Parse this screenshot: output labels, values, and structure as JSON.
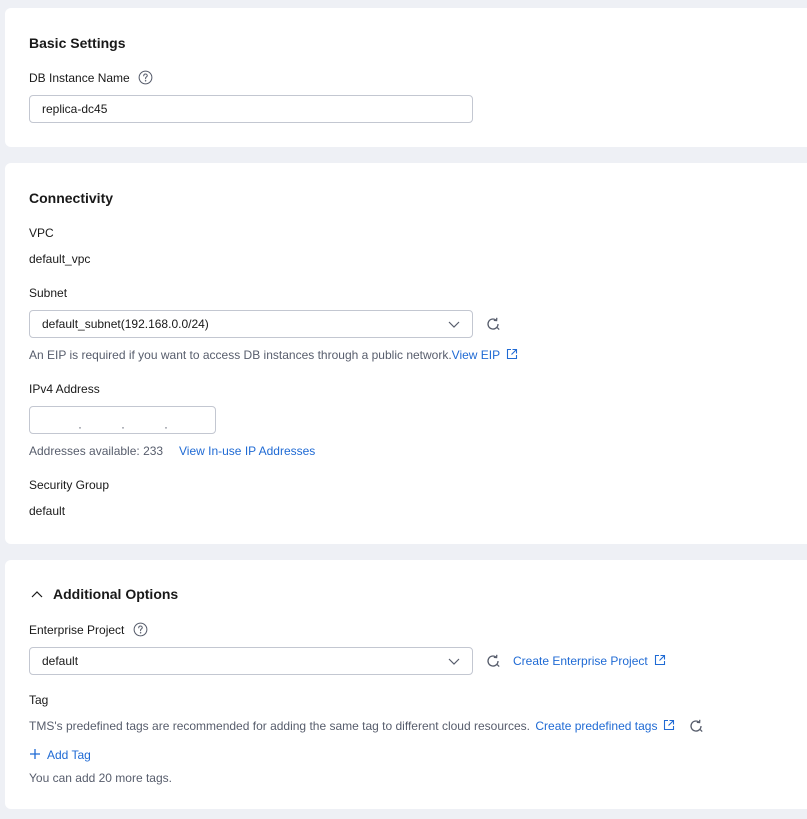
{
  "basic": {
    "title": "Basic Settings",
    "db_name_label": "DB Instance Name",
    "db_name_value": "replica-dc45"
  },
  "connectivity": {
    "title": "Connectivity",
    "vpc_label": "VPC",
    "vpc_value": "default_vpc",
    "subnet_label": "Subnet",
    "subnet_value": "default_subnet(192.168.0.0/24)",
    "eip_hint": "An EIP is required if you want to access DB instances through a public network.",
    "view_eip_link": "View EIP",
    "ipv4_label": "IPv4 Address",
    "ip_dots": [
      "·",
      "·",
      "·"
    ],
    "addresses_available": "Addresses available: 233",
    "view_inuse_link": "View In-use IP Addresses",
    "security_group_label": "Security Group",
    "security_group_value": "default"
  },
  "additional": {
    "title": "Additional Options",
    "enterprise_project_label": "Enterprise Project",
    "enterprise_project_value": "default",
    "create_enterprise_link": "Create Enterprise Project",
    "tag_label": "Tag",
    "tag_hint": "TMS's predefined tags are recommended for adding the same tag to different cloud resources.",
    "create_predefined_link": "Create predefined tags",
    "add_tag_label": "Add Tag",
    "tags_remaining": "You can add 20 more tags."
  },
  "colors": {
    "page_bg": "#eef0f5",
    "card_bg": "#ffffff",
    "link": "#1f6ad4",
    "border": "#c3c7d1",
    "hint": "#8a8e99"
  },
  "icons": [
    "help-icon",
    "chevron-down-icon",
    "refresh-icon",
    "external-link-icon",
    "chevron-up-icon",
    "plus-icon"
  ]
}
